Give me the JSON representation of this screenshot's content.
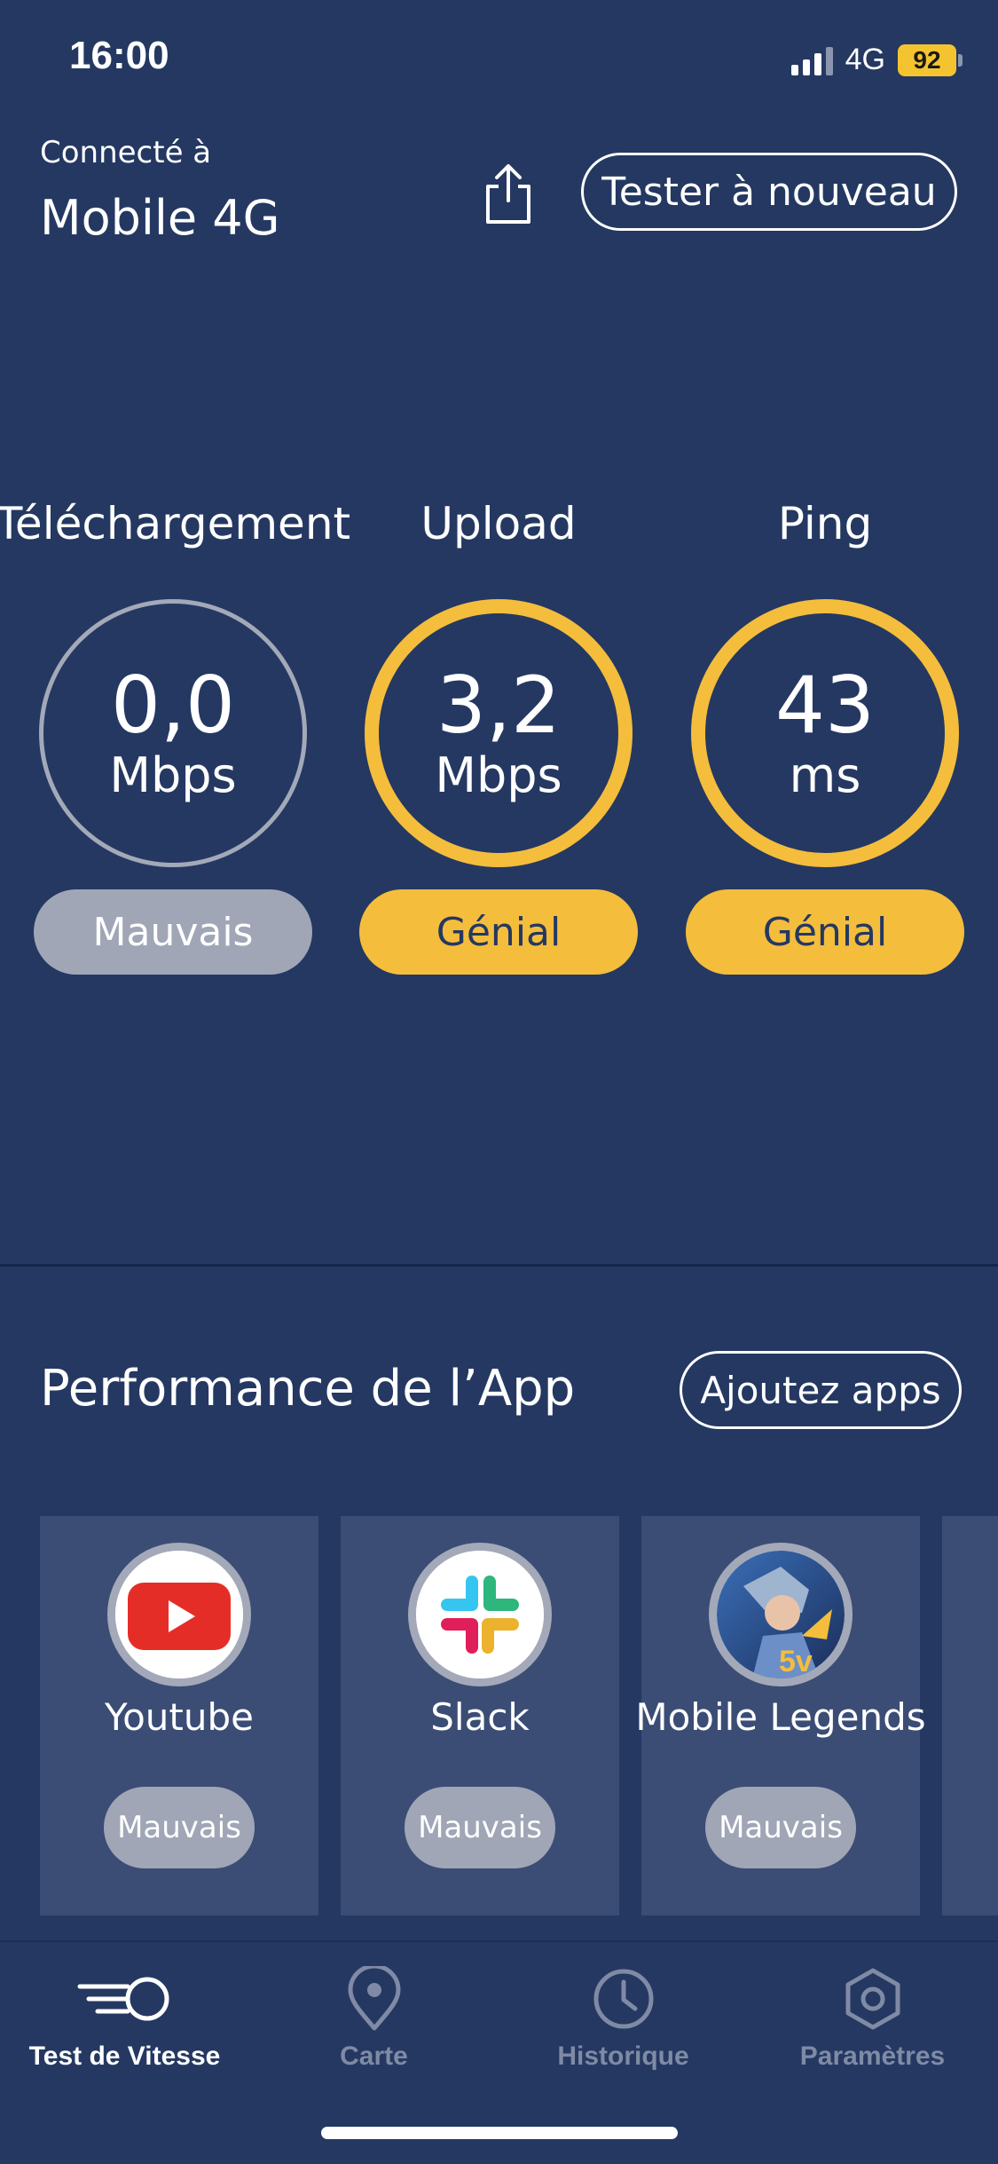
{
  "status_bar": {
    "time": "16:00",
    "network": "4G",
    "battery": "92",
    "signal_bars_active": 3,
    "signal_bars_total": 4
  },
  "header": {
    "connected_label": "Connecté à",
    "network_name": "Mobile 4G",
    "share_icon": "share-icon",
    "retest_label": "Tester à nouveau"
  },
  "metrics": [
    {
      "title": "Téléchargement",
      "value": "0,0",
      "unit": "Mbps",
      "rating": "Mauvais",
      "status": "bad"
    },
    {
      "title": "Upload",
      "value": "3,2",
      "unit": "Mbps",
      "rating": "Génial",
      "status": "good"
    },
    {
      "title": "Ping",
      "value": "43",
      "unit": "ms",
      "rating": "Génial",
      "status": "good"
    }
  ],
  "app_performance": {
    "title": "Performance de l’App",
    "add_apps_label": "Ajoutez apps",
    "apps": [
      {
        "name": "Youtube",
        "rating": "Mauvais",
        "icon": "youtube-icon"
      },
      {
        "name": "Slack",
        "rating": "Mauvais",
        "icon": "slack-icon"
      },
      {
        "name": "Mobile Legends",
        "rating": "Mauvais",
        "icon": "mobile-legends-icon"
      }
    ]
  },
  "tabbar": {
    "tabs": [
      {
        "label": "Test de Vitesse",
        "icon": "speed-icon",
        "active": true
      },
      {
        "label": "Carte",
        "icon": "map-pin-icon",
        "active": false
      },
      {
        "label": "Historique",
        "icon": "clock-icon",
        "active": false
      },
      {
        "label": "Paramètres",
        "icon": "settings-icon",
        "active": false
      }
    ]
  },
  "colors": {
    "background": "#243862",
    "accent_good": "#f4bd3c",
    "neutral_bad": "#a0a6b6",
    "card": "#3b4d75"
  }
}
